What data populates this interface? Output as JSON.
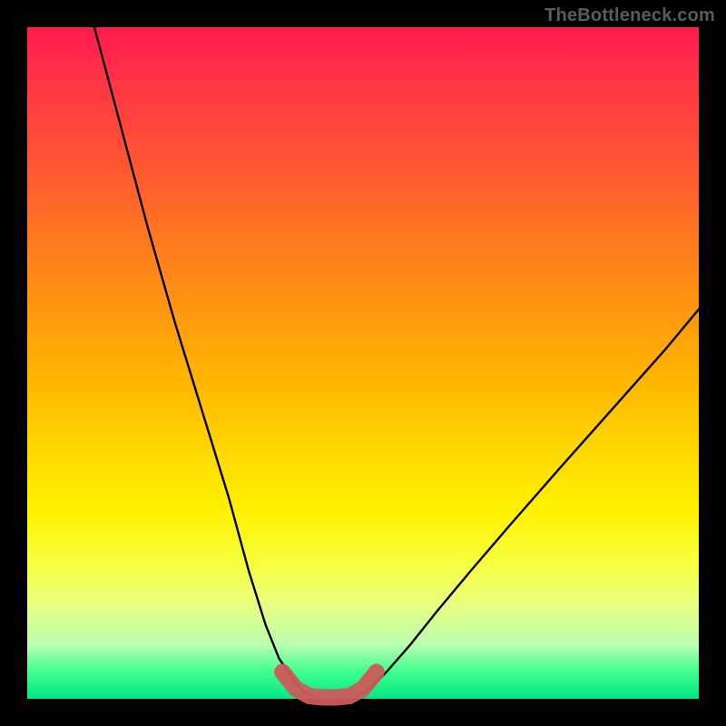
{
  "watermark": "TheBottleneck.com",
  "colors": {
    "frame": "#000000",
    "gradient_top": "#ff1a4d",
    "gradient_mid": "#ffd400",
    "gradient_bottom": "#00e886",
    "curve": "#000000",
    "marker": "#cf5a5a"
  },
  "chart_data": {
    "type": "line",
    "title": "",
    "xlabel": "",
    "ylabel": "",
    "xlim": [
      0,
      100
    ],
    "ylim": [
      0,
      100
    ],
    "series": [
      {
        "name": "left-curve",
        "x": [
          10,
          14,
          18,
          22,
          26,
          30,
          33,
          35.5,
          37.5,
          39.5,
          41,
          42.5
        ],
        "values": [
          100,
          85,
          70,
          56,
          43,
          30,
          19,
          11,
          6,
          3,
          1.2,
          0.4
        ]
      },
      {
        "name": "right-curve",
        "x": [
          49,
          51,
          53.5,
          57,
          61,
          66,
          72,
          79,
          87,
          95,
          100
        ],
        "values": [
          0.4,
          1.5,
          4,
          8,
          13,
          19,
          26,
          34,
          43,
          52,
          58
        ]
      },
      {
        "name": "bottom-marker",
        "x": [
          38,
          40,
          42,
          44,
          46,
          48,
          50,
          52
        ],
        "values": [
          4,
          1.5,
          0.4,
          0.2,
          0.2,
          0.4,
          1.5,
          4
        ]
      }
    ],
    "annotations": [
      {
        "text": "TheBottleneck.com",
        "position": "top-right"
      }
    ]
  }
}
